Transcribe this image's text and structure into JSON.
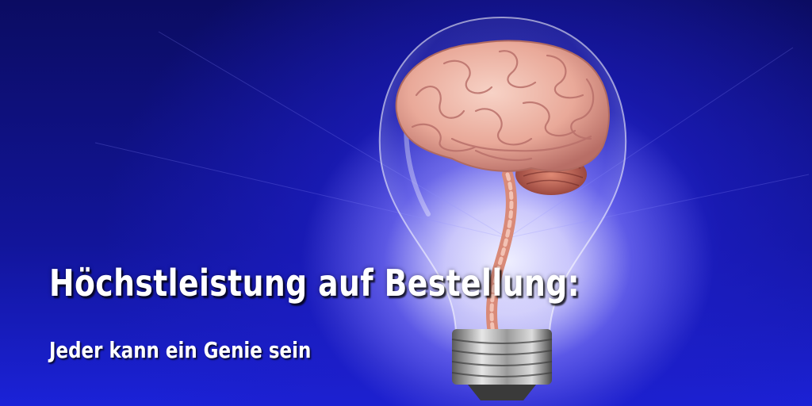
{
  "hero": {
    "headline": "Höchstleistung auf Bestellung:",
    "subline": "Jeder kann ein Genie sein"
  },
  "colors": {
    "background_dark": "#0b0c62",
    "background_light": "#1b22d8",
    "text": "#ffffff"
  },
  "illustration": {
    "icon": "lightbulb-with-brain-icon"
  }
}
